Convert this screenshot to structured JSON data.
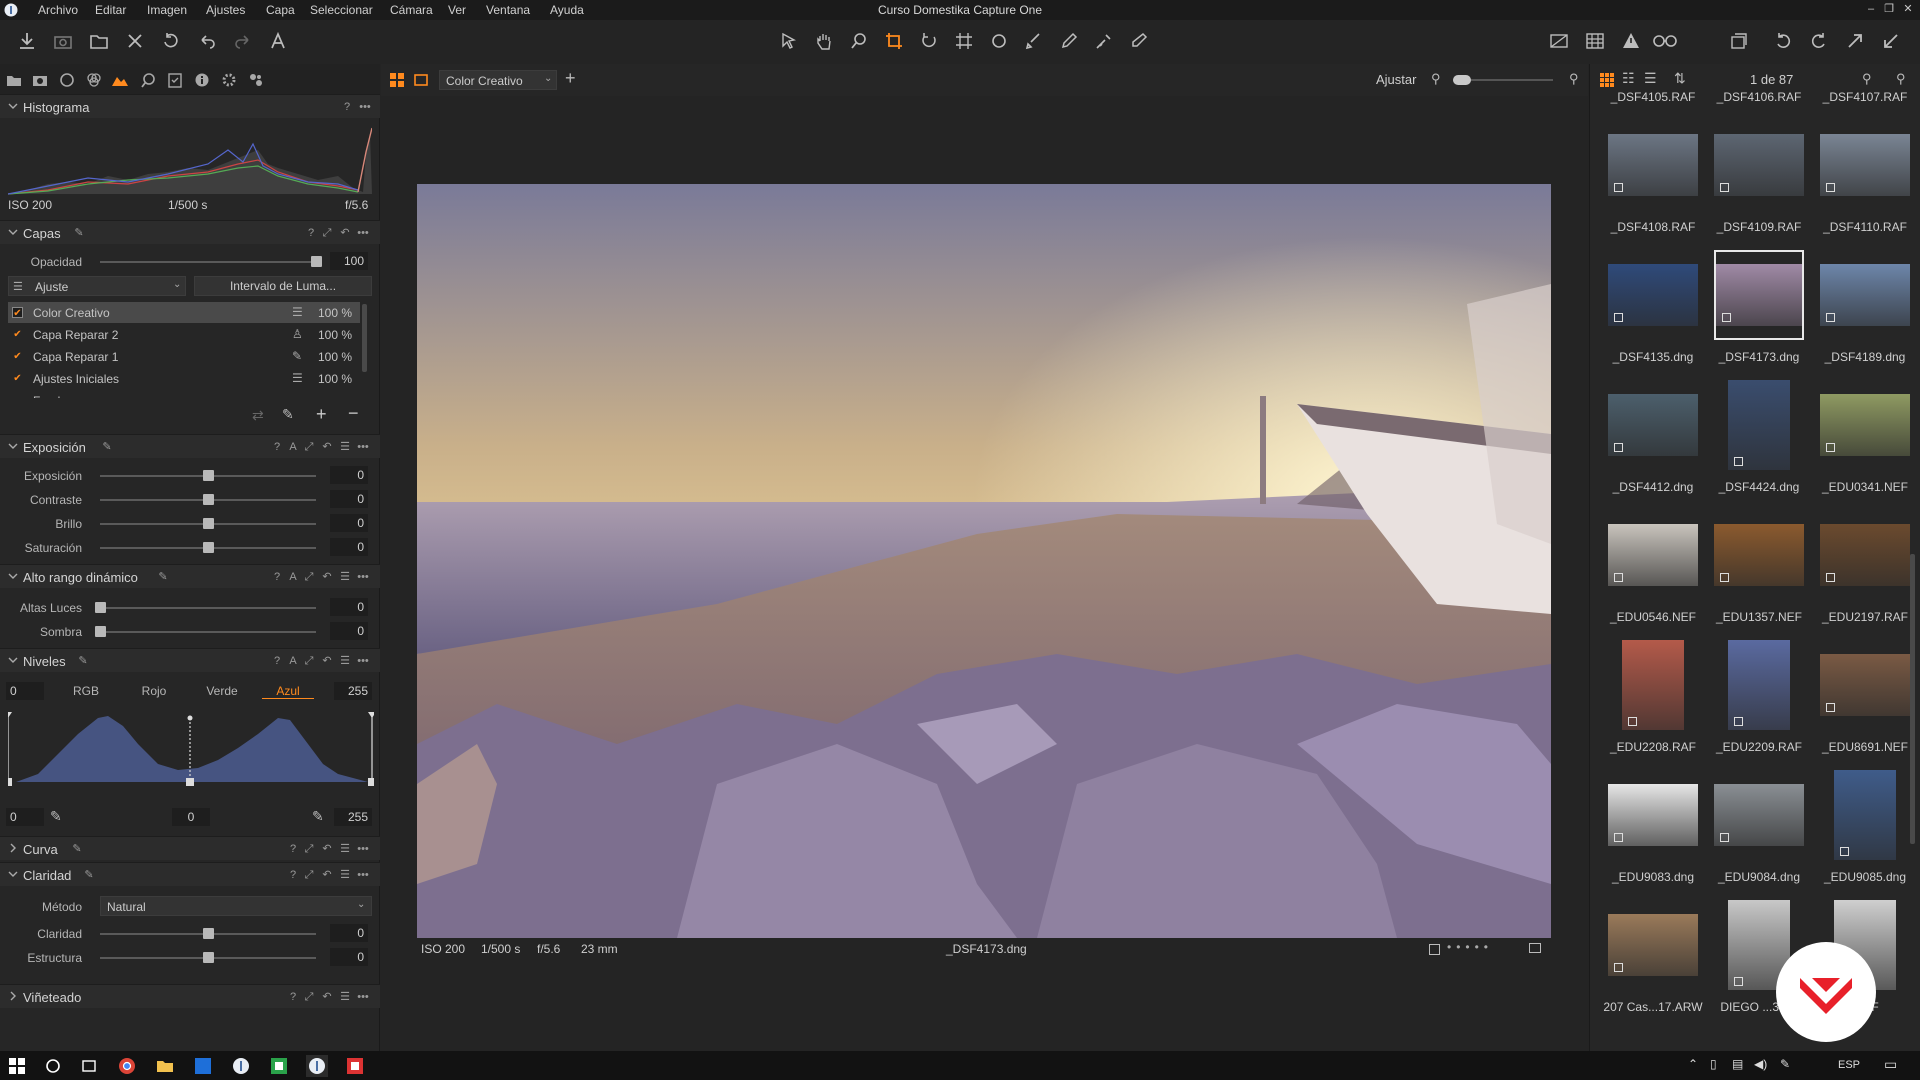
{
  "app": {
    "title": "Curso Domestika Capture One"
  },
  "menu": [
    "Archivo",
    "Editar",
    "Imagen",
    "Ajustes",
    "Capa",
    "Seleccionar",
    "Cámara",
    "Ver",
    "Ventana",
    "Ayuda"
  ],
  "histogram": {
    "title": "Histograma",
    "iso": "ISO 200",
    "shutter": "1/500 s",
    "aperture": "f/5.6"
  },
  "layers": {
    "title": "Capas",
    "opacity_label": "Opacidad",
    "opacity_value": "100",
    "opacity_level": 1.0,
    "adjust_label": "Ajuste",
    "luma_button": "Intervalo de Luma...",
    "items": [
      {
        "name": "Color Creativo",
        "pct": "100 %",
        "icon": "sliders-icon",
        "selected": true
      },
      {
        "name": "Capa Reparar 2",
        "pct": "100 %",
        "icon": "stamp-icon",
        "selected": false
      },
      {
        "name": "Capa Reparar 1",
        "pct": "100 %",
        "icon": "bandage-icon",
        "selected": false
      },
      {
        "name": "Ajustes Iniciales",
        "pct": "100 %",
        "icon": "sliders-icon",
        "selected": false
      },
      {
        "name": "Fondo",
        "pct": "",
        "icon": "",
        "selected": false
      }
    ]
  },
  "exposure": {
    "title": "Exposición",
    "sliders": [
      {
        "label": "Exposición",
        "value": "0",
        "level": 0.5
      },
      {
        "label": "Contraste",
        "value": "0",
        "level": 0.5
      },
      {
        "label": "Brillo",
        "value": "0",
        "level": 0.5
      },
      {
        "label": "Saturación",
        "value": "0",
        "level": 0.5
      }
    ]
  },
  "hdr": {
    "title": "Alto rango dinámico",
    "sliders": [
      {
        "label": "Altas Luces",
        "value": "0",
        "level": 0.0
      },
      {
        "label": "Sombra",
        "value": "0",
        "level": 0.0
      }
    ]
  },
  "levels": {
    "title": "Niveles",
    "input_low": "0",
    "input_high": "255",
    "channels": [
      "RGB",
      "Rojo",
      "Verde",
      "Azul"
    ],
    "active_channel": "Azul",
    "out_low": "0",
    "out_mid": "0",
    "out_high": "255"
  },
  "curve": {
    "title": "Curva"
  },
  "clarity": {
    "title": "Claridad",
    "method_label": "Método",
    "method_value": "Natural",
    "sliders": [
      {
        "label": "Claridad",
        "value": "0",
        "level": 0.5
      },
      {
        "label": "Estructura",
        "value": "0",
        "level": 0.5
      }
    ]
  },
  "vignette": {
    "title": "Viñeteado"
  },
  "viewer": {
    "variant": "Color Creativo",
    "fit_label": "Ajustar",
    "iso": "ISO 200",
    "shutter": "1/500 s",
    "aperture": "f/5.6",
    "focal": "23 mm",
    "filename": "_DSF4173.dng"
  },
  "browser": {
    "counter": "1 de 87",
    "top_names": [
      "_DSF4105.RAF",
      "_DSF4106.RAF",
      "_DSF4107.RAF"
    ],
    "thumbs": [
      {
        "name": "_DSF4108.RAF",
        "color": "#6c7684",
        "kind": "sky"
      },
      {
        "name": "_DSF4109.RAF",
        "color": "#5d6672",
        "kind": "sky"
      },
      {
        "name": "_DSF4110.RAF",
        "color": "#7a8594",
        "kind": "sky"
      },
      {
        "name": "_DSF4135.dng",
        "color": "#2f4a7a",
        "kind": "night"
      },
      {
        "name": "_DSF4173.dng",
        "color": "#a08aa6",
        "kind": "beach",
        "selected": true
      },
      {
        "name": "_DSF4189.dng",
        "color": "#6d86aa",
        "kind": "tanks"
      },
      {
        "name": "_DSF4412.dng",
        "color": "#4c5f6c",
        "kind": "mountain"
      },
      {
        "name": "_DSF4424.dng",
        "color": "#3a4d6e",
        "kind": "tall"
      },
      {
        "name": "_EDU0341.NEF",
        "color": "#8f9a62",
        "kind": "food"
      },
      {
        "name": "_EDU0546.NEF",
        "color": "#c9c4bd",
        "kind": "burger"
      },
      {
        "name": "_EDU1357.NEF",
        "color": "#8b5a2e",
        "kind": "burger2"
      },
      {
        "name": "_EDU2197.RAF",
        "color": "#6b4a2e",
        "kind": "coffee"
      },
      {
        "name": "_EDU2208.RAF",
        "color": "#b45a4a",
        "kind": "door"
      },
      {
        "name": "_EDU2209.RAF",
        "color": "#5a6aa0",
        "kind": "door2"
      },
      {
        "name": "_EDU8691.NEF",
        "color": "#7a5a44",
        "kind": "table"
      },
      {
        "name": "_EDU9083.dng",
        "color": "#e6e6e6",
        "kind": "house"
      },
      {
        "name": "_EDU9084.dng",
        "color": "#8a8f94",
        "kind": "house2"
      },
      {
        "name": "_EDU9085.dng",
        "color": "#3f5c8a",
        "kind": "house3"
      },
      {
        "name": "207 Cas...17.ARW",
        "color": "#9a7a5a",
        "kind": "building"
      },
      {
        "name": "DIEGO ...35.N",
        "color": "#c8c8c8",
        "kind": "person"
      },
      {
        "name": ".NEF",
        "color": "#cfcfcf",
        "kind": "person2"
      }
    ]
  },
  "taskbar": {
    "lang": "ESP"
  },
  "colors": {
    "accent": "#ff8a1e",
    "panel": "#262626",
    "domestika": "#e8202a"
  }
}
